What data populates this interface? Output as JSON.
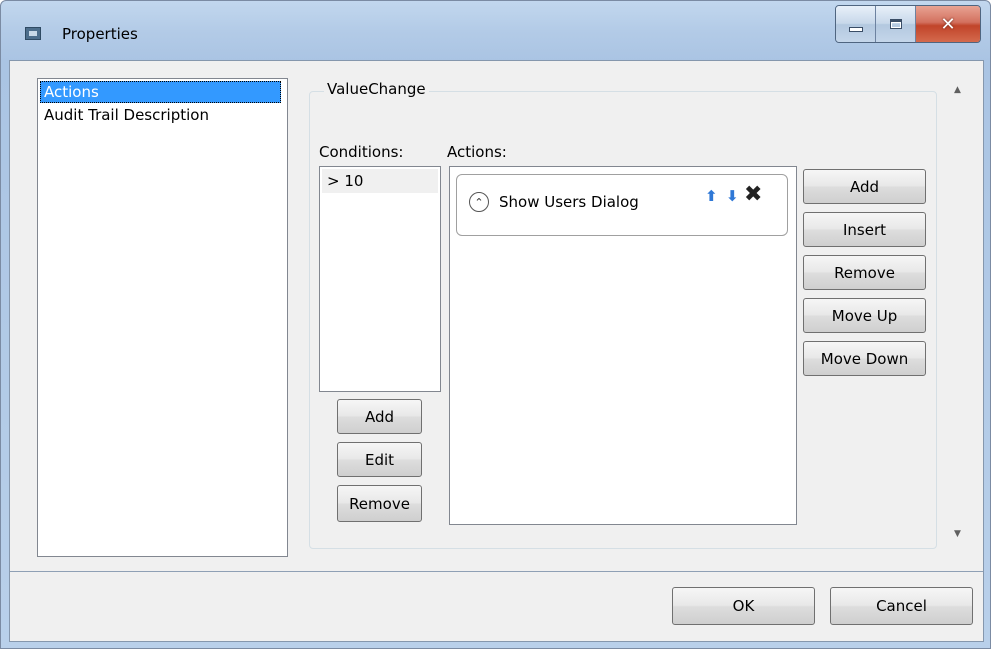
{
  "window": {
    "title": "Properties"
  },
  "caption": {
    "minimize_icon": "minimize-icon",
    "maximize_icon": "maximize-icon",
    "close_glyph": "✕"
  },
  "nav": {
    "items": [
      "Actions",
      "Audit Trail Description"
    ],
    "selected_index": 0
  },
  "group": {
    "title": "ValueChange"
  },
  "conditions": {
    "label": "Conditions:",
    "items": [
      "> 10"
    ],
    "buttons": {
      "add": "Add",
      "edit": "Edit",
      "remove": "Remove"
    }
  },
  "actions": {
    "label": "Actions:",
    "items": [
      {
        "text": "Show Users Dialog",
        "expand_glyph": "⌃",
        "up_glyph": "⬆",
        "down_glyph": "⬇",
        "delete_glyph": "✖"
      }
    ],
    "buttons": {
      "add": "Add",
      "insert": "Insert",
      "remove": "Remove",
      "move_up": "Move Up",
      "move_down": "Move Down"
    }
  },
  "scroll": {
    "up_glyph": "▲",
    "down_glyph": "▼"
  },
  "footer": {
    "ok": "OK",
    "cancel": "Cancel"
  }
}
